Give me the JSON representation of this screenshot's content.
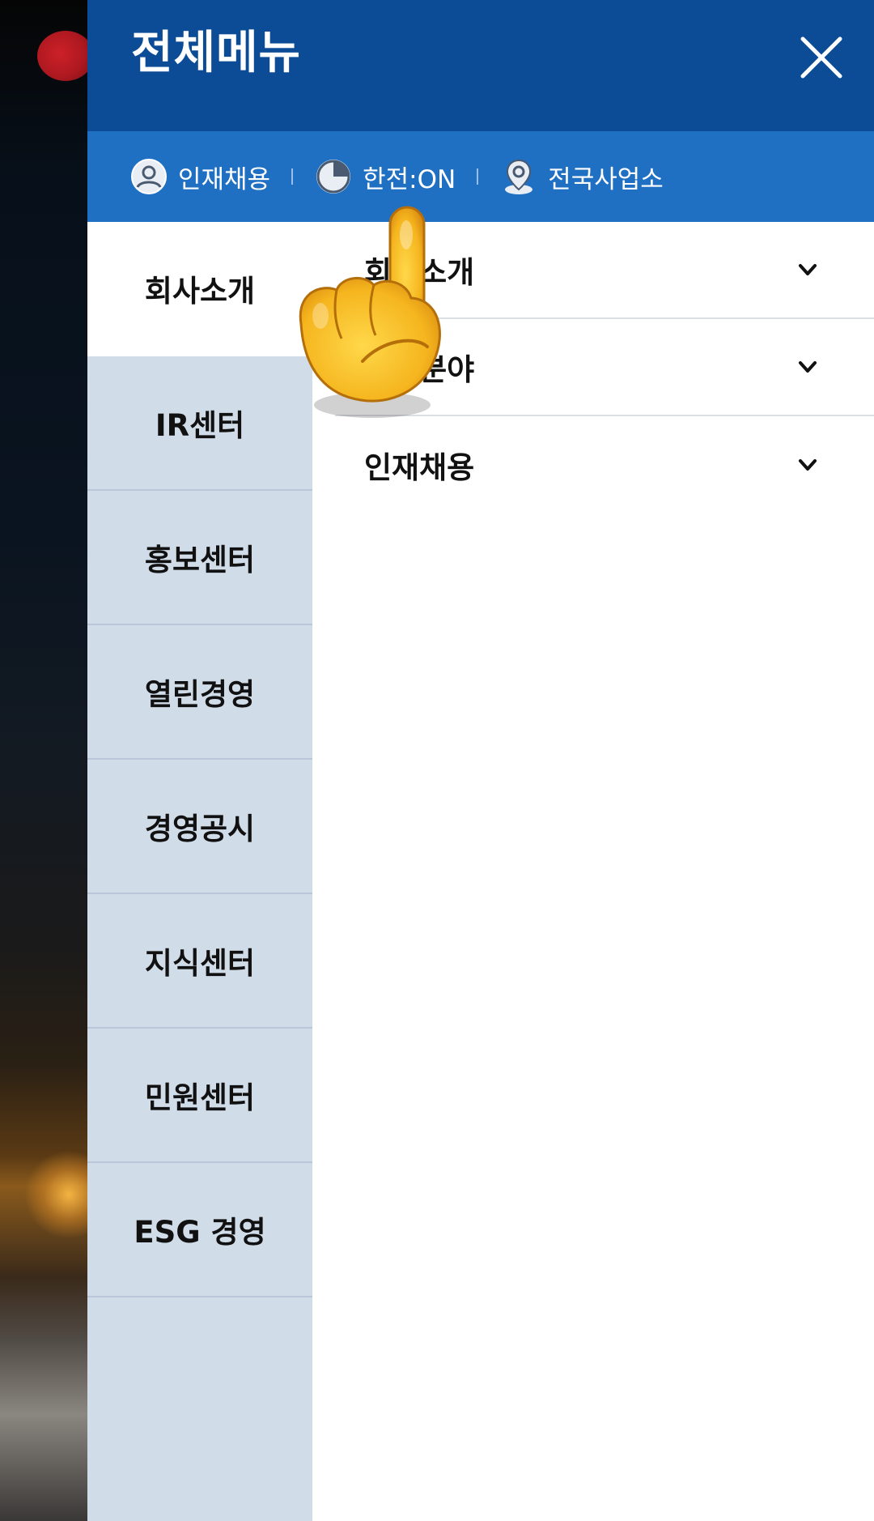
{
  "drawer": {
    "title": "전체메뉴",
    "close_icon": "close-icon"
  },
  "quick_links": [
    {
      "label": "인재채용",
      "icon": "user-icon"
    },
    {
      "label": "한전:ON",
      "icon": "pie-chart-icon"
    },
    {
      "label": "전국사업소",
      "icon": "location-pin-icon"
    }
  ],
  "categories": [
    {
      "label": "회사소개",
      "active": true
    },
    {
      "label": "IR센터"
    },
    {
      "label": "홍보센터"
    },
    {
      "label": "열린경영"
    },
    {
      "label": "경영공시"
    },
    {
      "label": "지식센터"
    },
    {
      "label": "민원센터"
    },
    {
      "label": "ESG 경영"
    }
  ],
  "submenu": [
    {
      "label": "회사소개",
      "icon": "chevron-down-icon"
    },
    {
      "label": "사업분야",
      "icon": "chevron-down-icon"
    },
    {
      "label": "인재채용",
      "icon": "chevron-down-icon"
    }
  ],
  "colors": {
    "header": "#0c4c96",
    "quick_bar": "#1f6fc3",
    "category_bg": "#d1dce9",
    "active_bg": "#ffffff"
  },
  "overlay_icon": "pointing-hand-icon"
}
